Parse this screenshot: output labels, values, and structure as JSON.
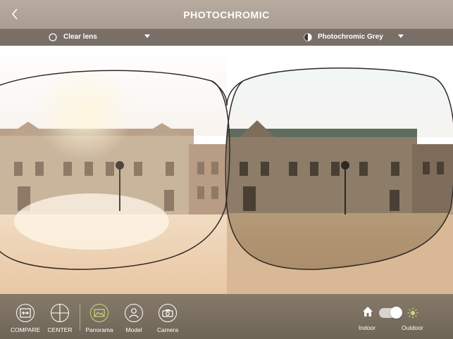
{
  "header": {
    "title": "PHOTOCHROMIC",
    "back_icon": "chevron-left-icon"
  },
  "lens_selector": {
    "left": {
      "label": "Clear lens",
      "icon": "empty-circle-icon"
    },
    "right": {
      "label": "Photochromic Grey",
      "icon": "half-circle-icon"
    }
  },
  "toolbar": {
    "tools": [
      {
        "key": "compare",
        "label": "COMPARE",
        "icon": "compare-icon",
        "active": false
      },
      {
        "key": "center",
        "label": "CENTER",
        "icon": "crosshair-icon",
        "active": false
      },
      {
        "key": "panorama",
        "label": "Panorama",
        "icon": "panorama-icon",
        "active": true
      },
      {
        "key": "model",
        "label": "Model",
        "icon": "person-icon",
        "active": false
      },
      {
        "key": "camera",
        "label": "Camera",
        "icon": "camera-icon",
        "active": false
      }
    ],
    "mode": {
      "indoor_label": "Indoor",
      "outdoor_label": "Outdoor",
      "outdoor_on": true
    }
  },
  "colors": {
    "header_bg": "#b0a397",
    "bar_bg": "#7a6f66",
    "toolbar_bg": "#7c7161",
    "active_accent": "#cfd77a"
  }
}
